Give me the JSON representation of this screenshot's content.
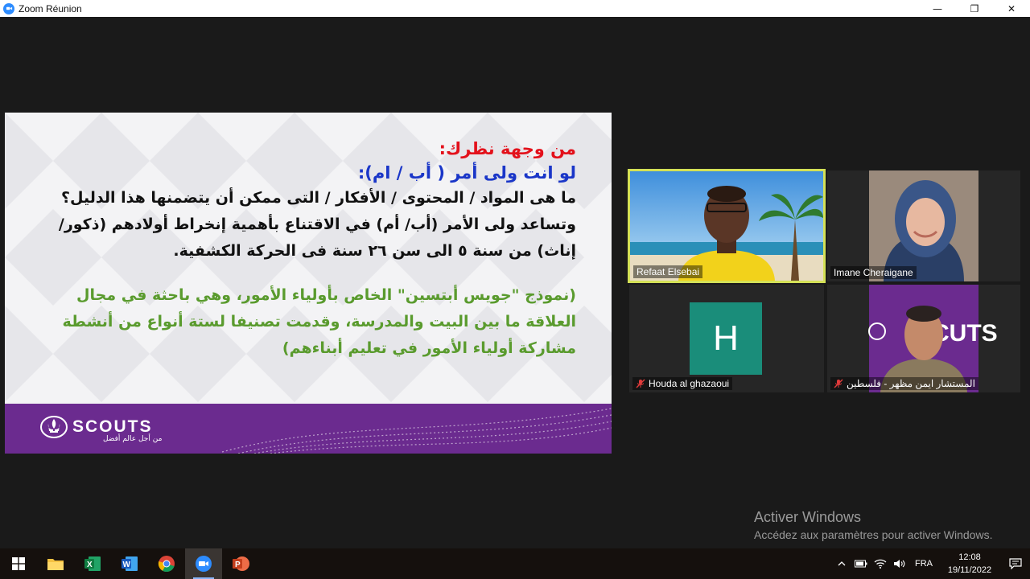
{
  "window": {
    "title": "Zoom Réunion",
    "minimize_glyph": "—",
    "restore_glyph": "❐",
    "close_glyph": "✕"
  },
  "slide": {
    "heading_red": "من وجهة نظرك:",
    "heading_blue": "لو انت ولى أمر ( أب / ام):",
    "para_black": "ما هى المواد / المحتوى / الأفكار / التى ممكن أن يتضمنها هذا الدليل؟ وتساعد ولى الأمر (أب/ أم) في الاقتناع بأهمية إنخراط أولادهم (ذكور/ إناث) من سنة ٥ الى سن ٢٦ سنة فى الحركة الكشفية.",
    "para_green": "(نموذج \"جويس أبتسين\" الخاص بأولياء الأمور، وهي باحثة في مجال العلاقة ما بين البيت والمدرسة، وقدمت تصنيفا لستة أنواع من أنشطة مشاركة أولياء الأمور في تعليم أبناءهم)",
    "logo_text": "SCOUTS",
    "logo_tagline": "من أجل عالم أفضل"
  },
  "participants": [
    {
      "name": "Refaat Elsebai",
      "muted": false,
      "speaking": true
    },
    {
      "name": "Imane Cheraigane",
      "muted": false,
      "speaking": false
    },
    {
      "name": "Houda al ghazaoui",
      "muted": true,
      "speaking": false,
      "avatar_letter": "H"
    },
    {
      "name": "المستشار ايمن مظهر - فلسطين",
      "muted": true,
      "speaking": false
    }
  ],
  "watermark": {
    "title": "Activer Windows",
    "subtitle": "Accédez aux paramètres pour activer Windows."
  },
  "taskbar": {
    "language": "FRA",
    "time": "12:08",
    "date": "19/11/2022",
    "apps": [
      "windows-start",
      "file-explorer",
      "excel",
      "word",
      "chrome",
      "zoom",
      "powerpoint"
    ],
    "active_app": "zoom"
  },
  "colors": {
    "speaker_border": "#d4e157",
    "slide_red": "#e3111b",
    "slide_blue": "#1a36c8",
    "slide_green": "#5a9b2e",
    "scouts_purple": "#6b2b8f",
    "avatar_teal": "#1a8d7a"
  }
}
